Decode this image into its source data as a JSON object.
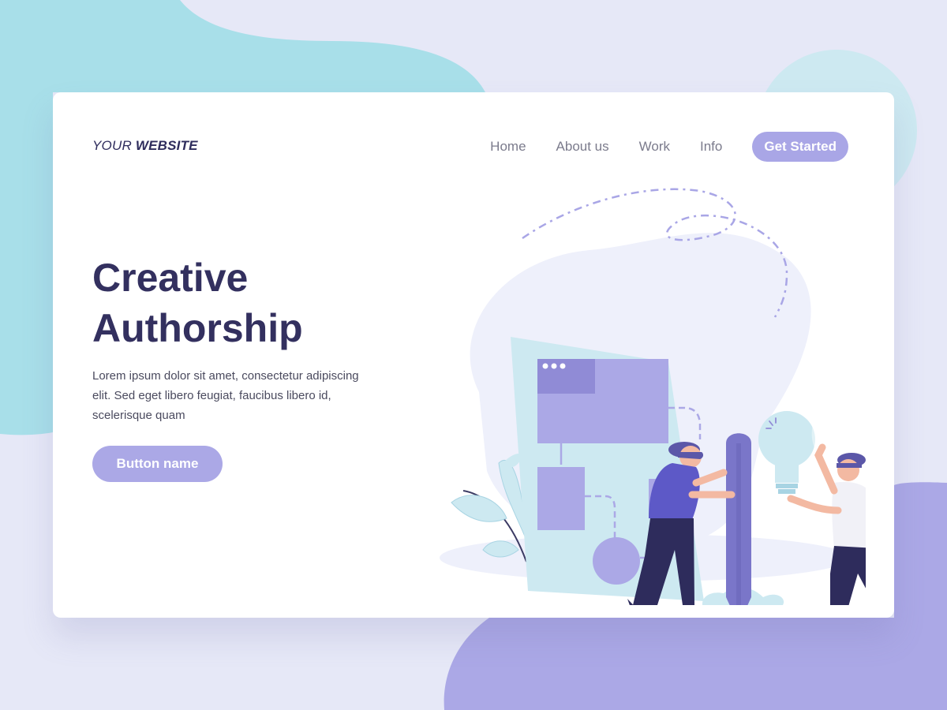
{
  "colors": {
    "accent": "#a9a6e6",
    "title": "#33305f",
    "background": "#e6e8f7",
    "teal_blob": "#a8dfe9",
    "purple_blob": "#aba8e6"
  },
  "header": {
    "logo_regular": "YOUR ",
    "logo_bold": "WEBSITE",
    "nav": [
      "Home",
      "About us",
      "Work",
      "Info"
    ],
    "cta": "Get Started"
  },
  "hero": {
    "title_line1": "Creative",
    "title_line2": "Authorship",
    "text": "Lorem ipsum dolor sit amet, consectetur adipiscing elit. Sed eget libero feugiat, faucibus libero id, scelerisque quam",
    "button": "Button name"
  },
  "illustration": {
    "icons": [
      "window-diagram-icon",
      "giant-pencil-icon",
      "lightbulb-icon",
      "leaf-plant-icon",
      "person-icon"
    ]
  }
}
